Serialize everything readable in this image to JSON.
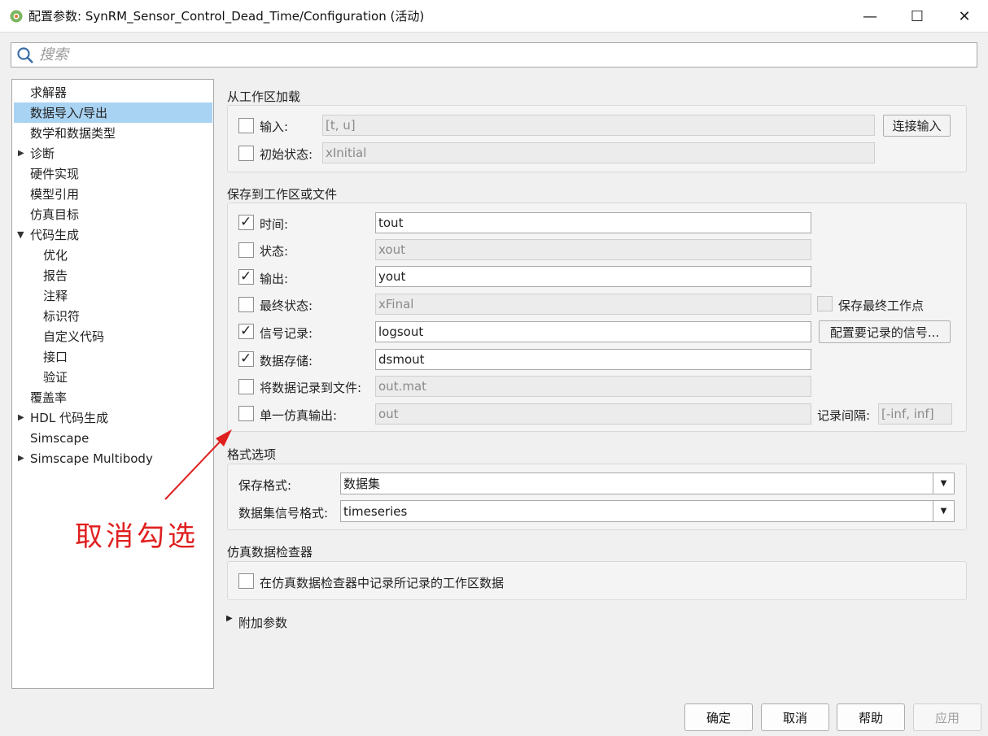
{
  "window": {
    "title": "配置参数: SynRM_Sensor_Control_Dead_Time/Configuration (活动)",
    "minimize": "—",
    "maximize": "☐",
    "close": "✕"
  },
  "search": {
    "placeholder": "搜索"
  },
  "tree": {
    "items": [
      {
        "label": "求解器"
      },
      {
        "label": "数据导入/导出",
        "selected": true
      },
      {
        "label": "数学和数据类型"
      },
      {
        "label": "诊断",
        "expandable": true
      },
      {
        "label": "硬件实现"
      },
      {
        "label": "模型引用"
      },
      {
        "label": "仿真目标"
      },
      {
        "label": "代码生成",
        "expanded": true
      },
      {
        "label": "优化"
      },
      {
        "label": "报告"
      },
      {
        "label": "注释"
      },
      {
        "label": "标识符"
      },
      {
        "label": "自定义代码"
      },
      {
        "label": "接口"
      },
      {
        "label": "验证"
      },
      {
        "label": "覆盖率"
      },
      {
        "label": "HDL 代码生成",
        "expandable": true
      },
      {
        "label": "Simscape"
      },
      {
        "label": "Simscape Multibody",
        "expandable": true
      }
    ]
  },
  "load": {
    "title": "从工作区加载",
    "input_label": "输入:",
    "input_value": "[t, u]",
    "input_checked": false,
    "connect_button": "连接输入",
    "initial_label": "初始状态:",
    "initial_value": "xInitial",
    "initial_checked": false
  },
  "save": {
    "title": "保存到工作区或文件",
    "rows": [
      {
        "label": "时间:",
        "value": "tout",
        "checked": true
      },
      {
        "label": "状态:",
        "value": "xout",
        "checked": false
      },
      {
        "label": "输出:",
        "value": "yout",
        "checked": true
      },
      {
        "label": "最终状态:",
        "value": "xFinal",
        "checked": false
      },
      {
        "label": "信号记录:",
        "value": "logsout",
        "checked": true
      },
      {
        "label": "数据存储:",
        "value": "dsmout",
        "checked": true
      },
      {
        "label": "将数据记录到文件:",
        "value": "out.mat",
        "checked": false
      },
      {
        "label": "单一仿真输出:",
        "value": "out",
        "checked": false
      }
    ],
    "save_final_op_label": "保存最终工作点",
    "configure_signals_button": "配置要记录的信号...",
    "log_interval_label": "记录间隔:",
    "log_interval_value": "[-inf, inf]"
  },
  "format": {
    "title": "格式选项",
    "save_format_label": "保存格式:",
    "save_format_value": "数据集",
    "signal_format_label": "数据集信号格式:",
    "signal_format_value": "timeseries"
  },
  "inspector": {
    "title": "仿真数据检查器",
    "record_label": "在仿真数据检查器中记录所记录的工作区数据",
    "record_checked": false
  },
  "additional": {
    "label": "附加参数"
  },
  "annotation": {
    "text": "取消勾选"
  },
  "footer": {
    "ok": "确定",
    "cancel": "取消",
    "help": "帮助",
    "apply": "应用"
  },
  "colors": {
    "selection": "#a9d3f3",
    "annotation": "#e02020"
  }
}
